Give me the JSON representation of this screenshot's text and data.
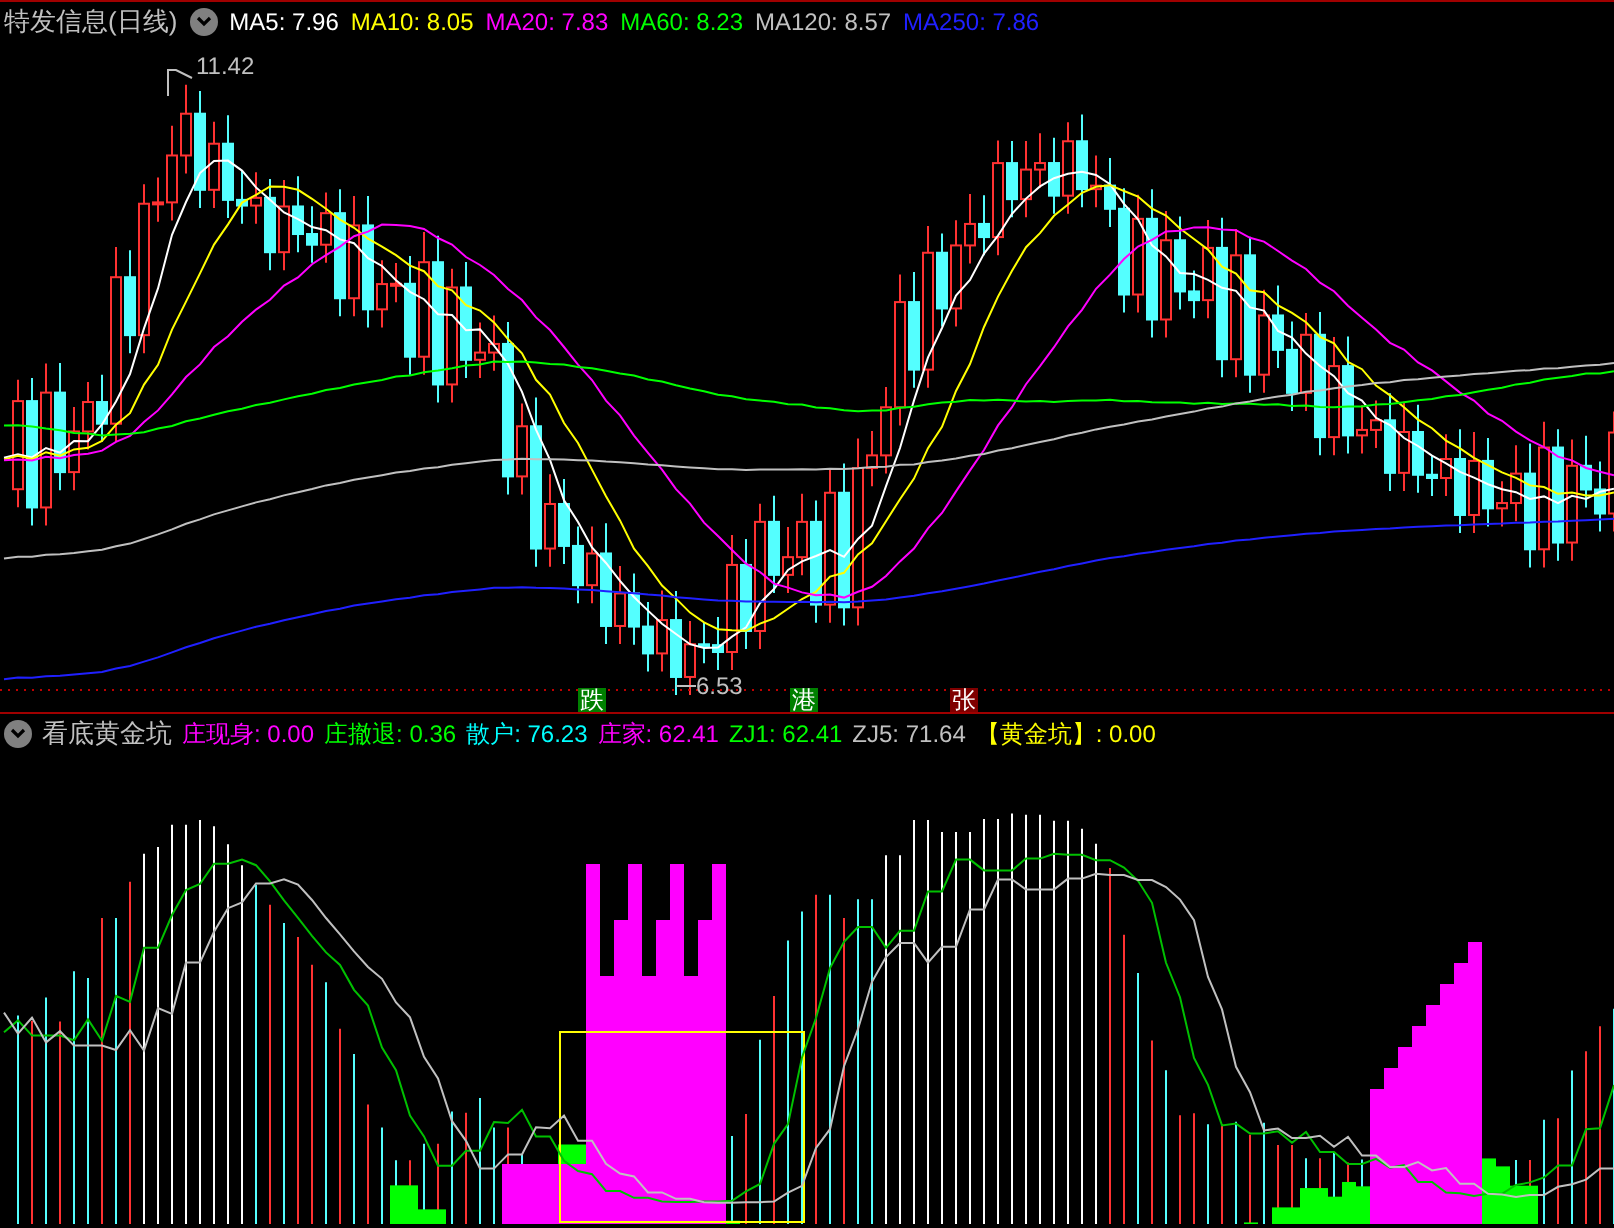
{
  "main_panel": {
    "title": "特发信息(日线)",
    "legend": [
      {
        "label": "MA5: 7.96",
        "color": "#ffffff"
      },
      {
        "label": "MA10: 8.05",
        "color": "#ffff00"
      },
      {
        "label": "MA20: 7.83",
        "color": "#ff00ff"
      },
      {
        "label": "MA60: 8.23",
        "color": "#00ff00"
      },
      {
        "label": "MA120: 8.57",
        "color": "#c0c0c0"
      },
      {
        "label": "MA250: 7.86",
        "color": "#2020ff"
      }
    ],
    "high_label": "11.42",
    "low_label": "6.53",
    "signals": [
      {
        "text": "跌",
        "color": "#008000"
      },
      {
        "text": "港",
        "color": "#008000"
      },
      {
        "text": "张",
        "color": "#800000"
      }
    ]
  },
  "indicator_panel": {
    "title": "看底黄金坑",
    "legend": [
      {
        "label": "庄现身: 0.00",
        "color": "#ff00ff"
      },
      {
        "label": "庄撤退: 0.36",
        "color": "#00ff00"
      },
      {
        "label": "散户: 76.23",
        "color": "#00ffff"
      },
      {
        "label": "庄家: 62.41",
        "color": "#ff00ff"
      },
      {
        "label": "ZJ1: 62.41",
        "color": "#00ff00"
      },
      {
        "label": "ZJ5: 71.64",
        "color": "#c0c0c0"
      },
      {
        "label": "【黄金坑】: 0.00",
        "color": "#ffff00"
      }
    ]
  }
}
